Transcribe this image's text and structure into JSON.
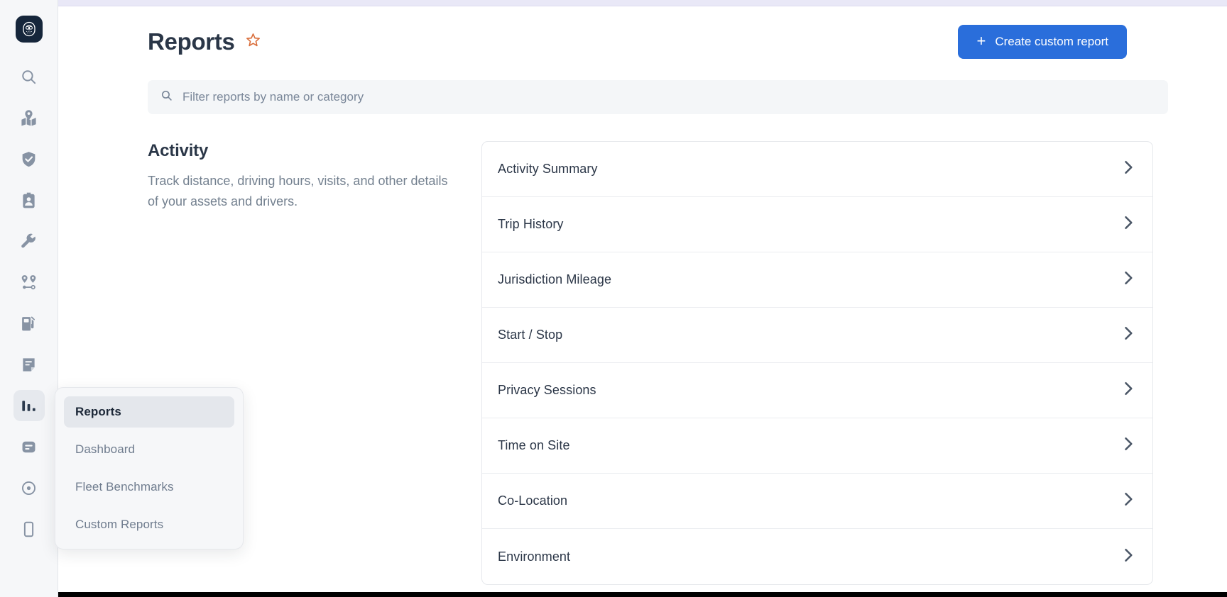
{
  "window": {
    "top_strip_color": "#e9e8f7",
    "accent_color": "#2a6edb",
    "star_color": "#d96d3a"
  },
  "rail": {
    "logo": {
      "icon": "owl-logo-icon",
      "label": "Owl logo"
    },
    "items": [
      {
        "icon": "search-icon",
        "label": "Search",
        "active": false
      },
      {
        "icon": "map-pin-icon",
        "label": "Map",
        "active": false
      },
      {
        "icon": "shield-check-icon",
        "label": "Safety",
        "active": false
      },
      {
        "icon": "id-badge-icon",
        "label": "Drivers",
        "active": false
      },
      {
        "icon": "wrench-icon",
        "label": "Maintenance",
        "active": false
      },
      {
        "icon": "route-icon",
        "label": "Trips",
        "active": false
      },
      {
        "icon": "fuel-pump-icon",
        "label": "Fuel",
        "active": false
      },
      {
        "icon": "document-icon",
        "label": "Documents",
        "active": false
      },
      {
        "icon": "bar-chart-icon",
        "label": "Reports",
        "active": true
      },
      {
        "icon": "list-card-icon",
        "label": "Dispatch",
        "active": false
      },
      {
        "icon": "target-dot-icon",
        "label": "Assets",
        "active": false
      },
      {
        "icon": "mobile-phone-icon",
        "label": "Mobile",
        "active": false
      }
    ]
  },
  "flyout": {
    "items": [
      {
        "label": "Reports",
        "selected": true
      },
      {
        "label": "Dashboard",
        "selected": false
      },
      {
        "label": "Fleet Benchmarks",
        "selected": false
      },
      {
        "label": "Custom Reports",
        "selected": false
      }
    ]
  },
  "header": {
    "title": "Reports",
    "favorite_icon": "star-outline-icon",
    "create_button": {
      "label": "Create custom report",
      "icon": "plus-icon"
    }
  },
  "search": {
    "icon": "search-icon",
    "placeholder": "Filter reports by name or category",
    "value": ""
  },
  "section": {
    "heading": "Activity",
    "description": "Track distance, driving hours, visits, and other details of your assets and drivers.",
    "reports": [
      {
        "label": "Activity Summary",
        "chevron": "chevron-right-icon"
      },
      {
        "label": "Trip History",
        "chevron": "chevron-right-icon"
      },
      {
        "label": "Jurisdiction Mileage",
        "chevron": "chevron-right-icon"
      },
      {
        "label": "Start / Stop",
        "chevron": "chevron-right-icon"
      },
      {
        "label": "Privacy Sessions",
        "chevron": "chevron-right-icon"
      },
      {
        "label": "Time on Site",
        "chevron": "chevron-right-icon"
      },
      {
        "label": "Co-Location",
        "chevron": "chevron-right-icon"
      },
      {
        "label": "Environment",
        "chevron": "chevron-right-icon"
      }
    ]
  }
}
